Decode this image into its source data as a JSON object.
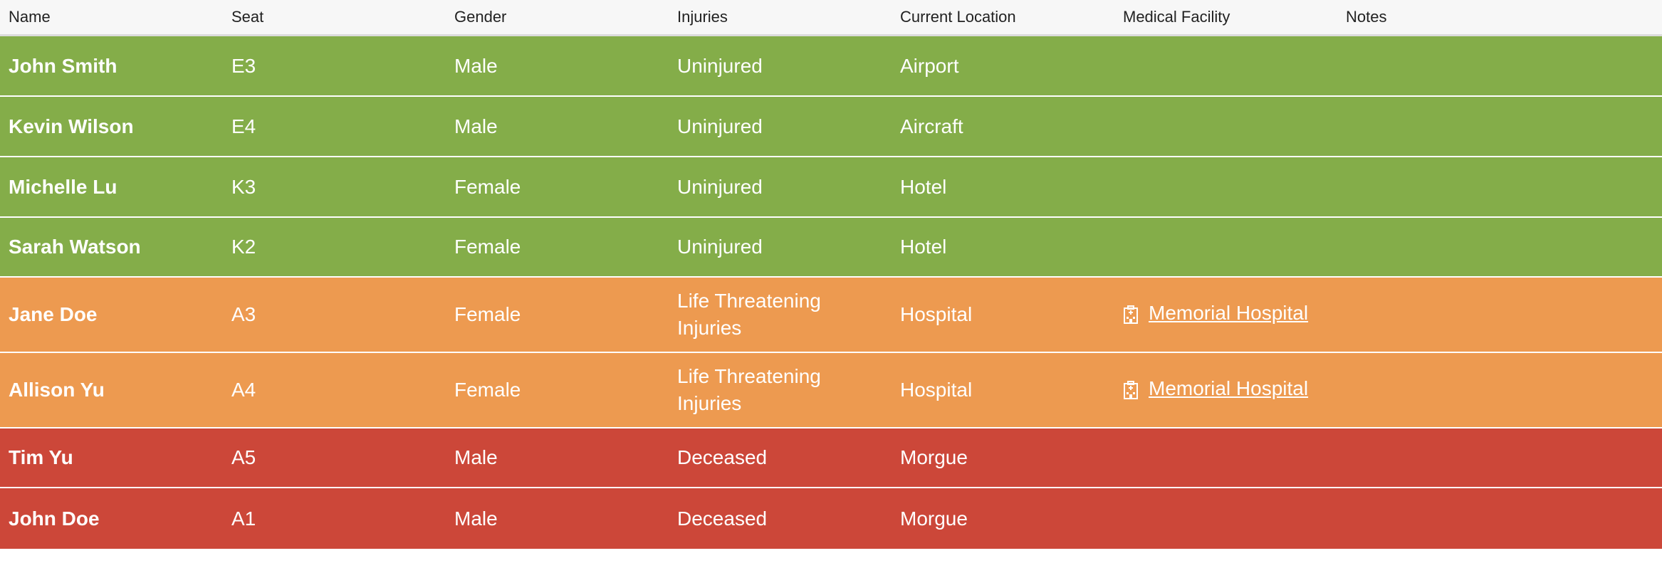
{
  "colors": {
    "uninjured": "#84ad49",
    "life_threatening": "#ed9a50",
    "deceased": "#cc4739",
    "header_bg": "#f7f7f7"
  },
  "header": {
    "name": "Name",
    "seat": "Seat",
    "gender": "Gender",
    "injuries": "Injuries",
    "location": "Current Location",
    "facility": "Medical Facility",
    "notes": "Notes"
  },
  "rows": [
    {
      "name": "John Smith",
      "seat": "E3",
      "gender": "Male",
      "injuries": "Uninjured",
      "location": "Airport",
      "facility": "",
      "status": "uninjured"
    },
    {
      "name": "Kevin Wilson",
      "seat": "E4",
      "gender": "Male",
      "injuries": "Uninjured",
      "location": "Aircraft",
      "facility": "",
      "status": "uninjured"
    },
    {
      "name": "Michelle Lu",
      "seat": "K3",
      "gender": "Female",
      "injuries": "Uninjured",
      "location": "Hotel",
      "facility": "",
      "status": "uninjured"
    },
    {
      "name": "Sarah Watson",
      "seat": "K2",
      "gender": "Female",
      "injuries": "Uninjured",
      "location": "Hotel",
      "facility": "",
      "status": "uninjured"
    },
    {
      "name": "Jane Doe",
      "seat": "A3",
      "gender": "Female",
      "injuries": "Life Threatening Injuries",
      "location": "Hospital",
      "facility": "Memorial Hospital",
      "facility_icon": "hospital-icon",
      "status": "life_threatening"
    },
    {
      "name": "Allison Yu",
      "seat": "A4",
      "gender": "Female",
      "injuries": "Life Threatening Injuries",
      "location": "Hospital",
      "facility": "Memorial Hospital",
      "facility_icon": "hospital-icon",
      "status": "life_threatening"
    },
    {
      "name": "Tim Yu",
      "seat": "A5",
      "gender": "Male",
      "injuries": "Deceased",
      "location": "Morgue",
      "facility": "",
      "status": "deceased"
    },
    {
      "name": "John Doe",
      "seat": "A1",
      "gender": "Male",
      "injuries": "Deceased",
      "location": "Morgue",
      "facility": "",
      "status": "deceased"
    }
  ]
}
